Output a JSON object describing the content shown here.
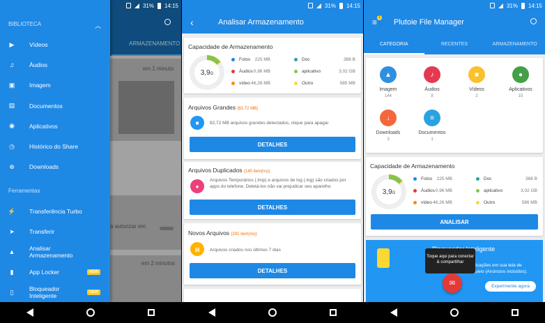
{
  "status": {
    "battery": "31%",
    "time": "14:15"
  },
  "p1": {
    "bg": {
      "tab": "ARMAZENAMENTO",
      "time1": "em 1 minuto",
      "autorizar": "a autorizar em",
      "time2": "em 2 minutos"
    },
    "library_title": "BIBLIOTECA",
    "library": [
      {
        "icon": "video-icon",
        "label": "Vídeos"
      },
      {
        "icon": "audio-icon",
        "label": "Áudios"
      },
      {
        "icon": "image-icon",
        "label": "Imagem"
      },
      {
        "icon": "document-icon",
        "label": "Documentos"
      },
      {
        "icon": "android-icon",
        "label": "Aplicativos"
      },
      {
        "icon": "history-icon",
        "label": "Histórico do Share"
      },
      {
        "icon": "download-icon",
        "label": "Downloads"
      }
    ],
    "tools_title": "Ferramentas",
    "tools": [
      {
        "icon": "lightning-icon",
        "label": "Transferência Turbo",
        "badge": ""
      },
      {
        "icon": "transfer-icon",
        "label": "Transferir",
        "badge": ""
      },
      {
        "icon": "analyze-icon",
        "label": "Analisar Armazenamento",
        "badge": ""
      },
      {
        "icon": "lock-icon",
        "label": "App Locker",
        "badge": "NEW"
      },
      {
        "icon": "phone-lock-icon",
        "label": "Bloqueador Inteligente",
        "badge": "NEW"
      }
    ]
  },
  "p2": {
    "title": "Analisar Armazenamento",
    "capacity": {
      "title": "Capacidade de Armazenamento",
      "total": "3,9",
      "unit": "G"
    },
    "legend_left": [
      {
        "name": "Fotos",
        "value": "225 MB",
        "color": "#1e88e5"
      },
      {
        "name": "Áudios",
        "value": "0,96 MB",
        "color": "#e53935"
      },
      {
        "name": "vídeo",
        "value": "46,26 MB",
        "color": "#fb8c00"
      }
    ],
    "legend_right": [
      {
        "name": "Doc",
        "value": "388 B",
        "color": "#26a69a"
      },
      {
        "name": "aplicativo",
        "value": "3,02 GB",
        "color": "#8bc34a"
      },
      {
        "name": "Outro",
        "value": "585 MB",
        "color": "#fdd835"
      }
    ],
    "large": {
      "title": "Arquivos Grandes",
      "count": "(82,72 MB)",
      "desc": "82,72 MB arquivos grandes detectados, clique para apagar",
      "btn": "DETALHES"
    },
    "dup": {
      "title": "Arquivos Duplicados",
      "count": "(140 item(ns))",
      "desc": "Arquivos Temporários (.tmp) e arquivos de log (.log) são criados por apps do telefone. Deletá-los não vai prejudicar seu aparelho",
      "btn": "DETALHES"
    },
    "newf": {
      "title": "Novos Arquivos",
      "count": "(291 item(ns))",
      "desc": "Arquivos criados nos últimos 7 dias",
      "btn": "DETALHES"
    }
  },
  "p3": {
    "title": "Plutoie File Manager",
    "badge": "1",
    "tabs": [
      "CATEGORIA",
      "RECENTES",
      "ARMAZENAMENTO"
    ],
    "categories": [
      {
        "icon": "image-icon",
        "label": "Imagem",
        "count": "144",
        "color": "#2f8fe0",
        "glyph": "▲"
      },
      {
        "icon": "music-icon",
        "label": "Áudios",
        "count": "8",
        "color": "#e53950",
        "glyph": "♪"
      },
      {
        "icon": "video-icon",
        "label": "Vídeos",
        "count": "2",
        "color": "#fbc02d",
        "glyph": "■"
      },
      {
        "icon": "android-icon",
        "label": "Aplicativos",
        "count": "15",
        "color": "#43a047",
        "glyph": "●"
      },
      {
        "icon": "download-icon",
        "label": "Downloads",
        "count": "3",
        "color": "#f4673d",
        "glyph": "↓"
      },
      {
        "icon": "document-icon",
        "label": "Documentos",
        "count": "1",
        "color": "#29a3e0",
        "glyph": "≡"
      }
    ],
    "capacity": {
      "title": "Capacidade de Armazenamento",
      "total": "3,9",
      "unit": "G"
    },
    "legend_left": [
      {
        "name": "Fotos",
        "value": "225 MB",
        "color": "#1e88e5"
      },
      {
        "name": "Áudios",
        "value": "0,96 MB",
        "color": "#e53935"
      },
      {
        "name": "vídeo",
        "value": "46,26 MB",
        "color": "#fb8c00"
      }
    ],
    "legend_right": [
      {
        "name": "Doc",
        "value": "388 B",
        "color": "#26a69a"
      },
      {
        "name": "aplicativo",
        "value": "3,02 GB",
        "color": "#8bc34a"
      },
      {
        "name": "Outro",
        "value": "586 MB",
        "color": "#fdd835"
      }
    ],
    "analyze_btn": "ANALISAR",
    "promo": {
      "title": "Bloqueador Inteligente",
      "text": "notificações em sua tela de bloqueio (Anúncios incluídos).",
      "btn": "Experimente agora"
    },
    "tooltip": "Toque aqui para conectar & compartilhar"
  }
}
